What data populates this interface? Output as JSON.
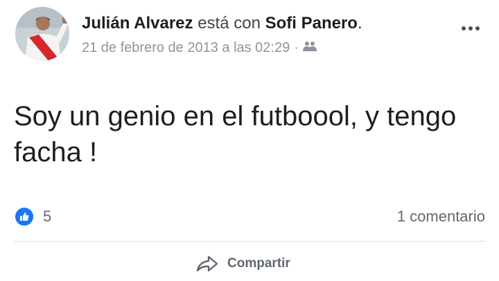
{
  "post": {
    "author": "Julián Alvarez",
    "connector": "está con",
    "tagged": "Sofi Panero",
    "end_punct": ".",
    "timestamp": "21 de febrero de 2013 a las 02:29",
    "separator": "·",
    "audience_icon": "friends-icon",
    "text": "Soy un genio en el futboool, y tengo facha !",
    "reactions_count": "5",
    "comments_label": "1 comentario",
    "share_label": "Compartir"
  },
  "colors": {
    "like_blue": "#1877f2",
    "meta_gray": "#8d949e",
    "text": "#1c1e21"
  }
}
